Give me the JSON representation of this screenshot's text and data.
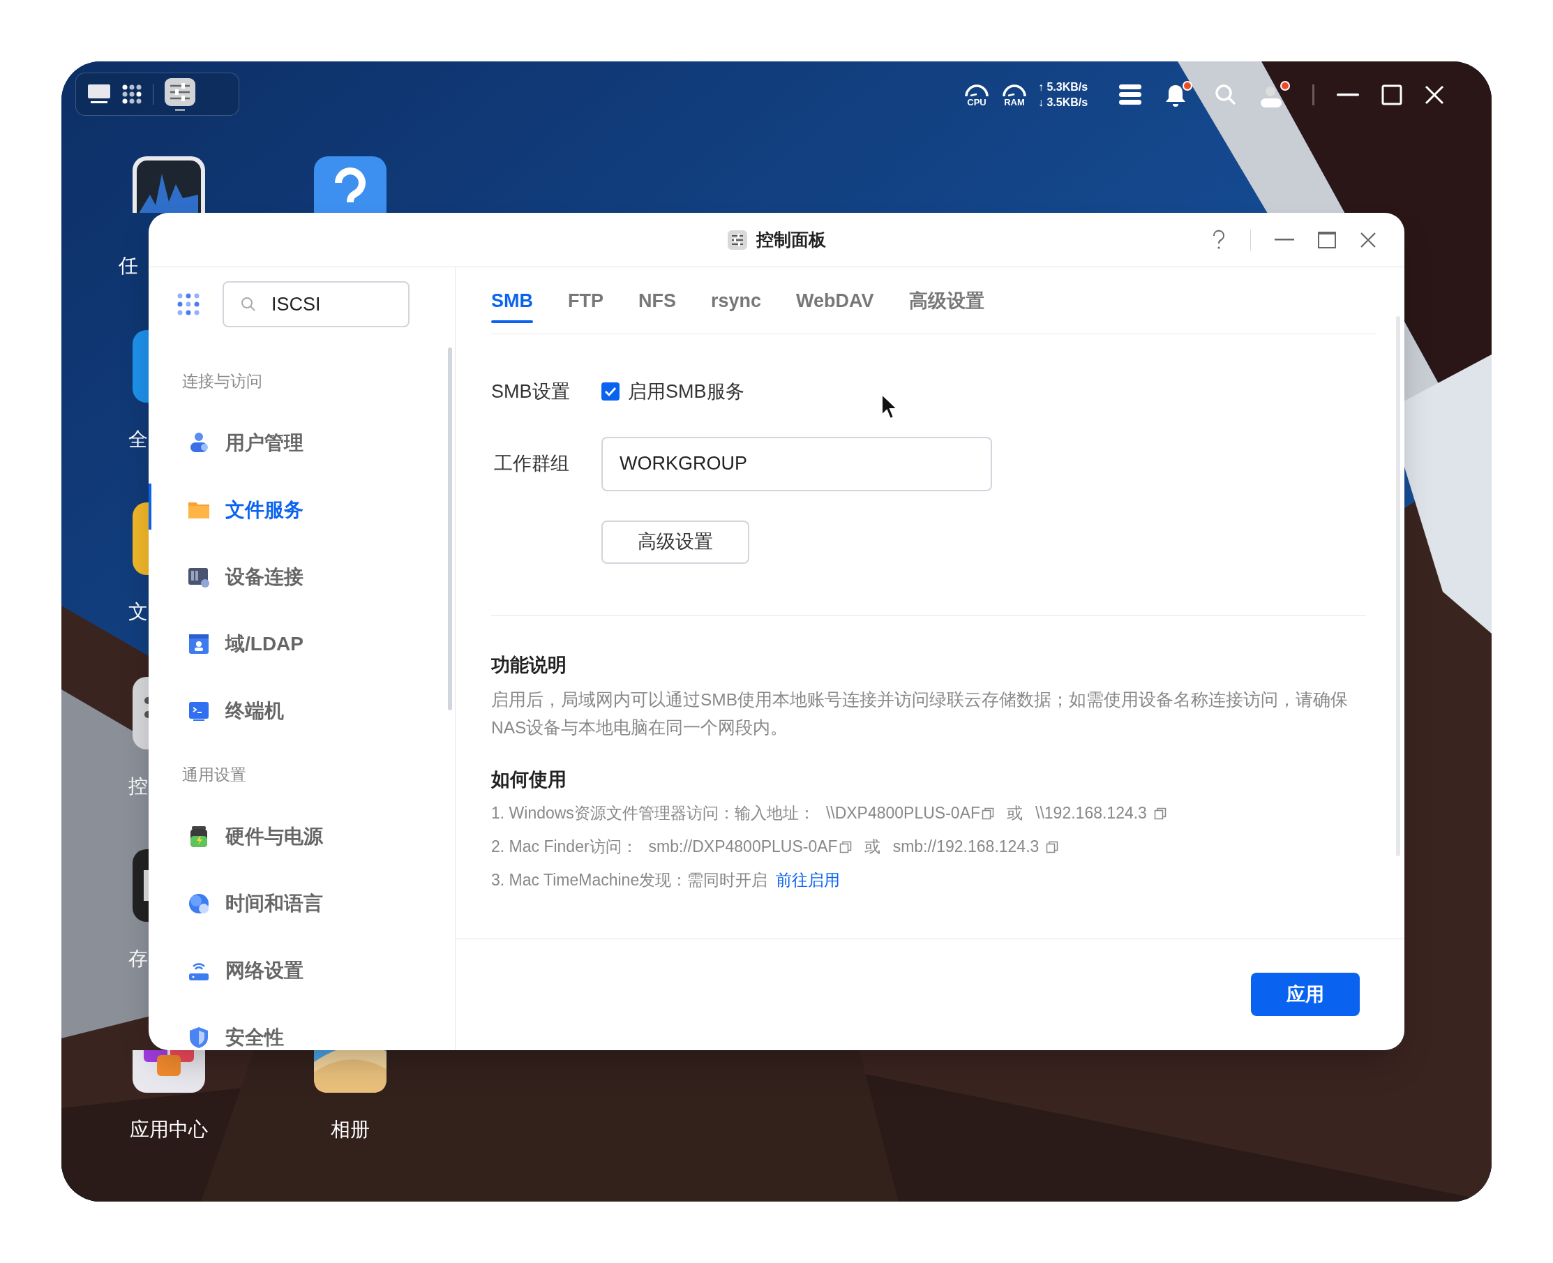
{
  "dock": {
    "items": [
      {
        "kind": "monitor",
        "selected": false
      },
      {
        "kind": "grid",
        "selected": false
      },
      {
        "kind": "panel",
        "selected": true
      }
    ]
  },
  "status_bar": {
    "cpu_label": "CPU",
    "ram_label": "RAM",
    "upload": "↑ 5.3KB/s",
    "download": "↓ 3.5KB/s",
    "notification_badge": true,
    "user_badge": true
  },
  "desktop_icons": [
    {
      "kind": "monitor",
      "label": "任"
    },
    {
      "kind": "help"
    },
    {
      "kind": "blue",
      "label": "全"
    },
    {
      "kind": "yellow",
      "label": "文"
    },
    {
      "kind": "gray",
      "label": "控"
    },
    {
      "kind": "dark",
      "label": "存"
    },
    {
      "kind": "appcenter",
      "label": "应用中心"
    },
    {
      "kind": "photos",
      "label": "相册"
    }
  ],
  "window": {
    "title": "控制面板"
  },
  "sidebar": {
    "search": {
      "value": "ISCSI"
    },
    "sections": [
      {
        "title": "连接与访问",
        "items": [
          {
            "label": "用户管理",
            "kind": "users",
            "selected": false
          },
          {
            "label": "文件服务",
            "kind": "folder",
            "selected": true
          },
          {
            "label": "设备连接",
            "kind": "device",
            "selected": false
          },
          {
            "label": "域/LDAP",
            "kind": "ldap",
            "selected": false
          },
          {
            "label": "终端机",
            "kind": "terminal",
            "selected": false
          }
        ]
      },
      {
        "title": "通用设置",
        "items": [
          {
            "label": "硬件与电源",
            "kind": "battery",
            "selected": false
          },
          {
            "label": "时间和语言",
            "kind": "globe",
            "selected": false
          },
          {
            "label": "网络设置",
            "kind": "router",
            "selected": false
          },
          {
            "label": "安全性",
            "kind": "shield",
            "selected": false
          }
        ]
      }
    ]
  },
  "tabs": [
    {
      "label": "SMB",
      "selected": true
    },
    {
      "label": "FTP",
      "selected": false
    },
    {
      "label": "NFS",
      "selected": false
    },
    {
      "label": "rsync",
      "selected": false
    },
    {
      "label": "WebDAV",
      "selected": false
    },
    {
      "label": "高级设置",
      "selected": false
    }
  ],
  "smb": {
    "label": "SMB设置",
    "enable": {
      "label": "启用SMB服务",
      "checked": true
    },
    "workgroup": {
      "label": "工作群组",
      "value": "WORKGROUP"
    },
    "advanced_button": "高级设置"
  },
  "description": {
    "title": "功能说明",
    "text": "启用后，局域网内可以通过SMB使用本地账号连接并访问绿联云存储数据；如需使用设备名称连接访问，请确保NAS设备与本地电脑在同一个网段内。"
  },
  "usage": {
    "title": "如何使用",
    "steps": [
      {
        "kind": "addresses",
        "prefix": "1. Windows资源文件管理器访问：输入地址：",
        "first": "\\\\DXP4800PLUS-0AF",
        "or": "或",
        "second": "\\\\192.168.124.3"
      },
      {
        "kind": "addresses",
        "prefix": "2. Mac Finder访问：",
        "first": "smb://DXP4800PLUS-0AF",
        "or": "或",
        "second": "smb://192.168.124.3"
      },
      {
        "kind": "link",
        "prefix": "3. Mac TimeMachine发现：需同时开启",
        "link": "前往启用"
      }
    ]
  },
  "apply_button": "应用"
}
